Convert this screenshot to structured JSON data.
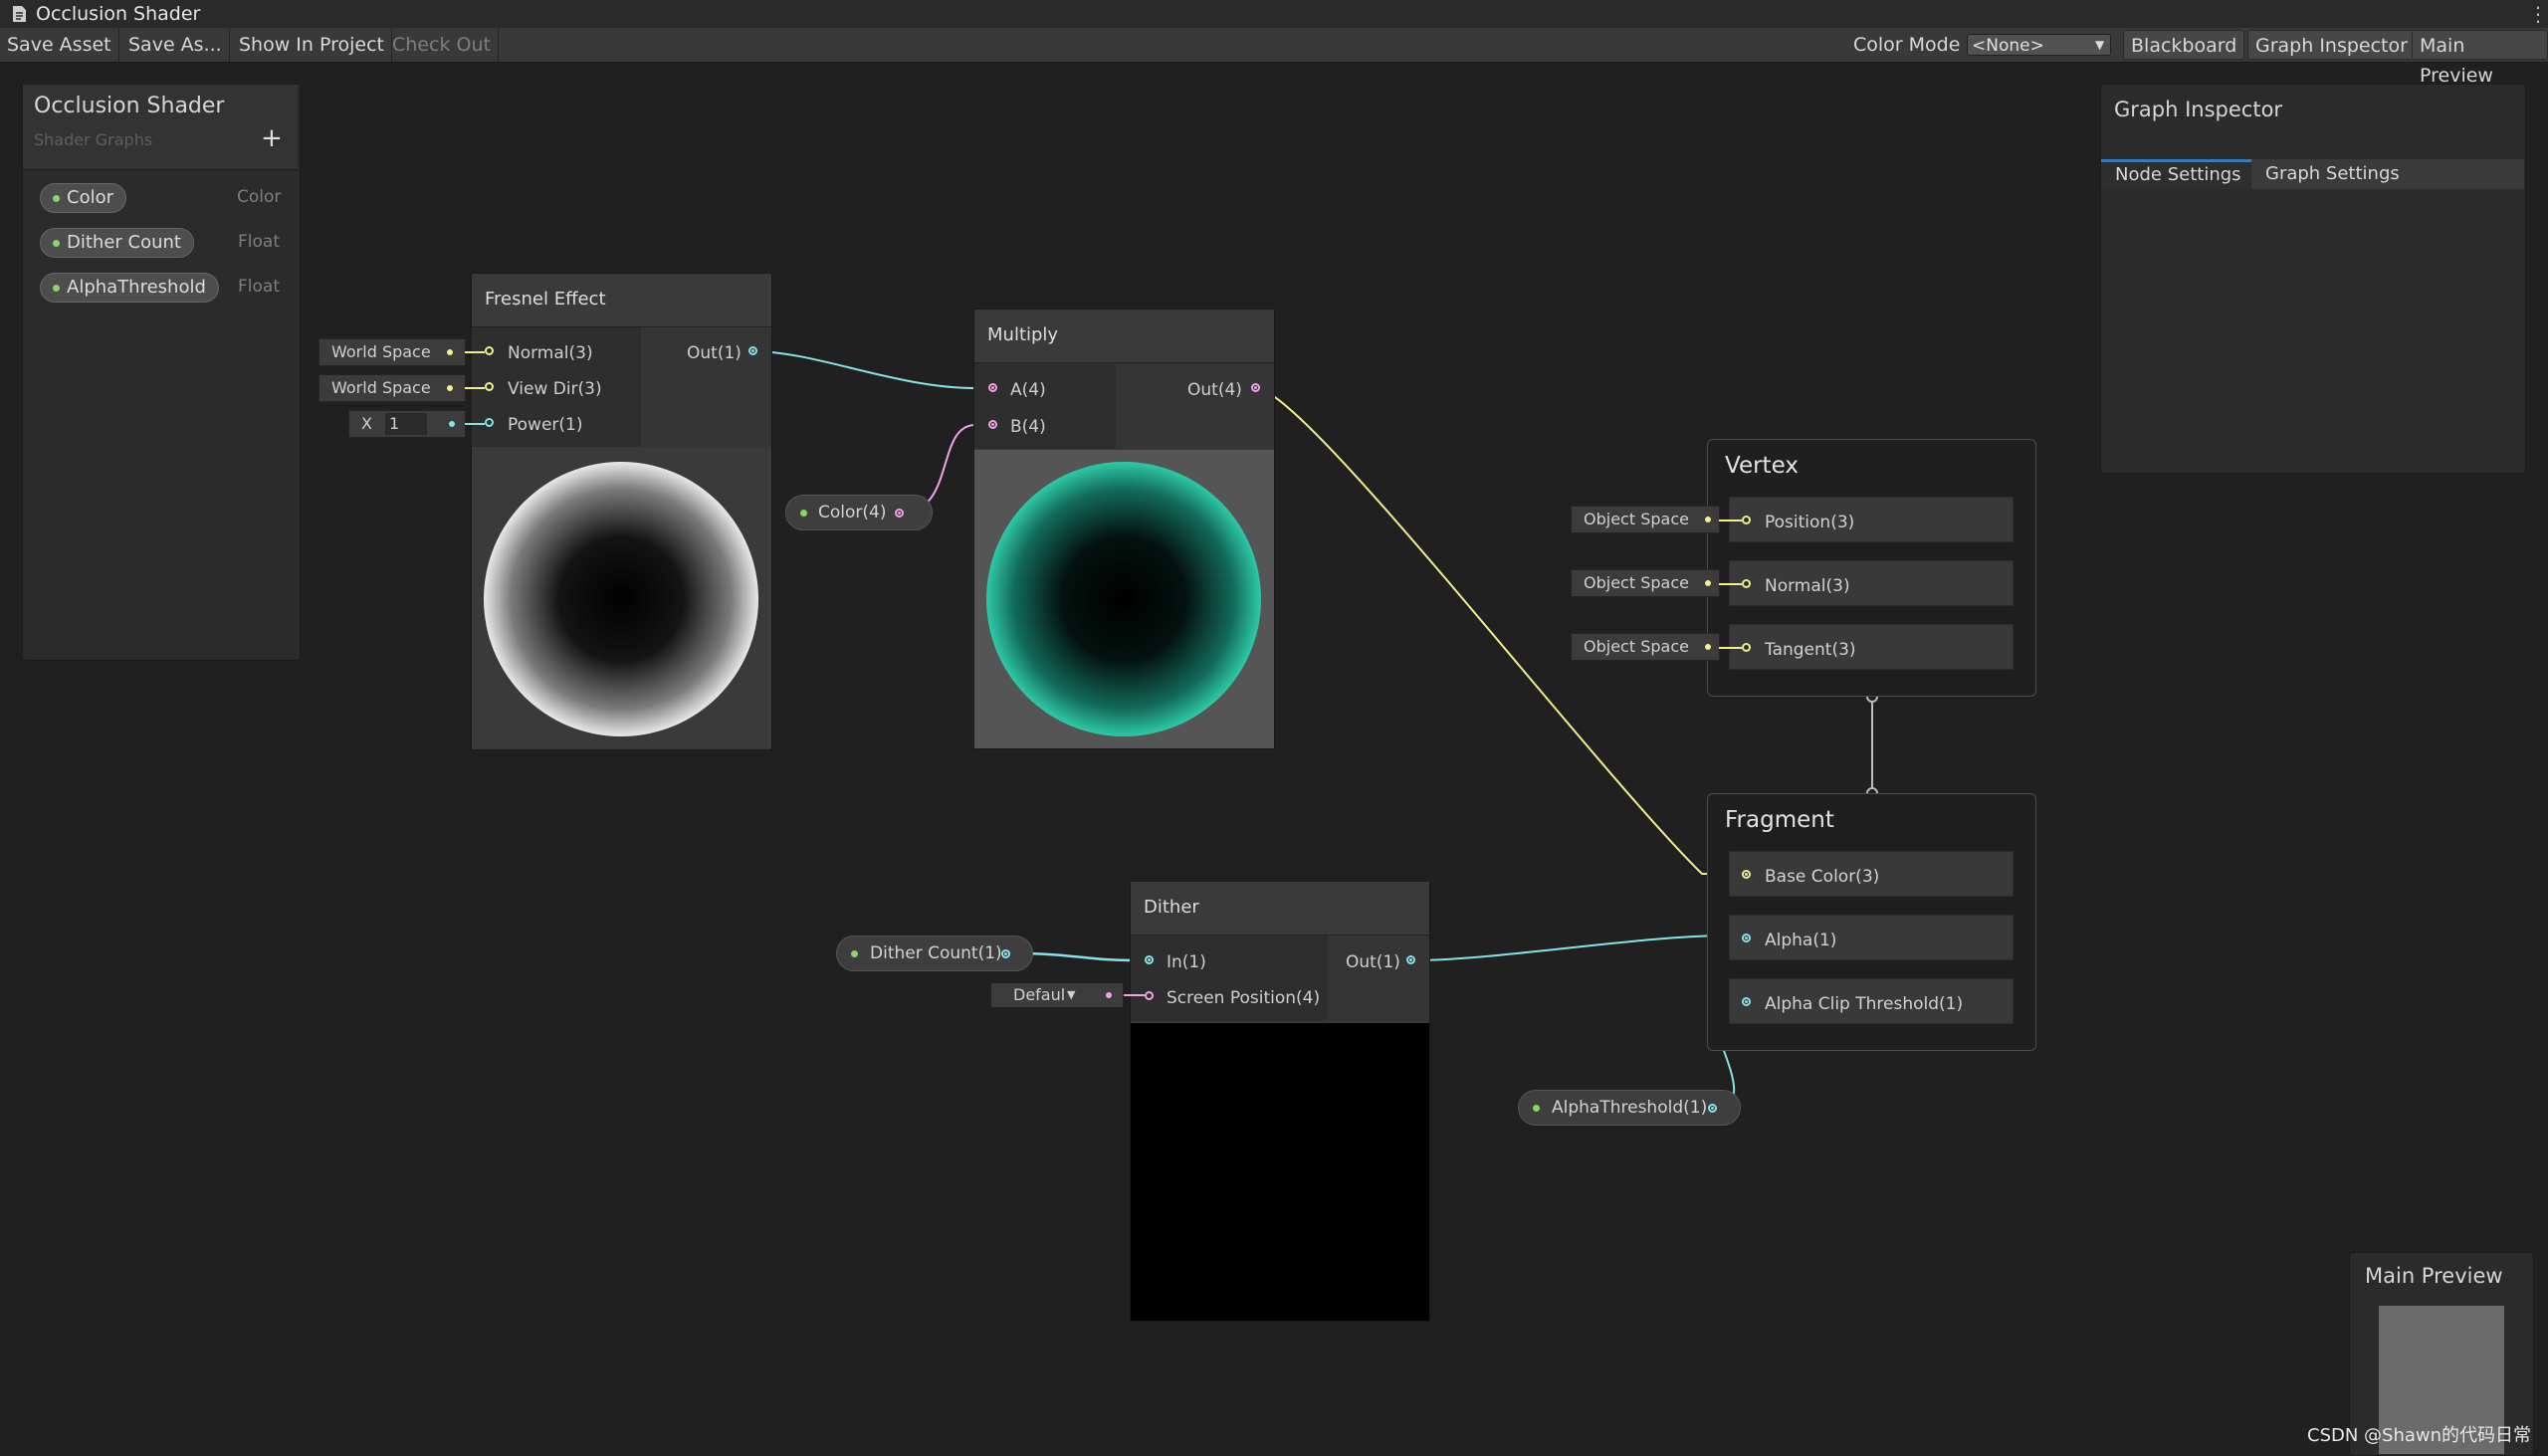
{
  "window": {
    "title": "Occlusion Shader"
  },
  "toolbar": {
    "save_asset": "Save Asset",
    "save_as": "Save As...",
    "show_in_project": "Show In Project",
    "check_out": "Check Out",
    "color_mode_label": "Color Mode",
    "color_mode_value": "<None>",
    "blackboard": "Blackboard",
    "graph_inspector": "Graph Inspector",
    "main_preview": "Main Preview"
  },
  "blackboard": {
    "title": "Occlusion Shader",
    "subtitle": "Shader Graphs",
    "add": "+",
    "properties": [
      {
        "name": "Color",
        "type": "Color"
      },
      {
        "name": "Dither Count",
        "type": "Float"
      },
      {
        "name": "AlphaThreshold",
        "type": "Float"
      }
    ]
  },
  "fresnel": {
    "title": "Fresnel Effect",
    "inputs": [
      "Normal(3)",
      "View Dir(3)",
      "Power(1)"
    ],
    "output": "Out(1)",
    "normal_space": "World Space",
    "viewdir_space": "World Space",
    "power_axis": "X",
    "power_value": "1"
  },
  "multiply": {
    "title": "Multiply",
    "inputs": [
      "A(4)",
      "B(4)"
    ],
    "output": "Out(4)"
  },
  "color_prop": {
    "label": "Color(4)"
  },
  "dither": {
    "title": "Dither",
    "inputs": [
      "In(1)",
      "Screen Position(4)"
    ],
    "output": "Out(1)",
    "screenpos_mode": "Defaul"
  },
  "dither_count_prop": {
    "label": "Dither Count(1)"
  },
  "alpha_threshold_prop": {
    "label": "AlphaThreshold(1)"
  },
  "vertex": {
    "title": "Vertex",
    "blocks": [
      "Position(3)",
      "Normal(3)",
      "Tangent(3)"
    ],
    "spaces": [
      "Object Space",
      "Object Space",
      "Object Space"
    ]
  },
  "fragment": {
    "title": "Fragment",
    "blocks": [
      "Base Color(3)",
      "Alpha(1)",
      "Alpha Clip Threshold(1)"
    ]
  },
  "inspector": {
    "title": "Graph Inspector",
    "tabs": [
      "Node Settings",
      "Graph Settings"
    ]
  },
  "preview": {
    "title": "Main Preview"
  },
  "watermark": "CSDN @Shawn的代码日常",
  "colors": {
    "vec3_port": "#f3f08c",
    "vec1_port": "#84e4e7",
    "vec4_port": "#f1a3e6",
    "property_dot": "#8cd36a",
    "preview_teal": "#2ec9a6"
  }
}
